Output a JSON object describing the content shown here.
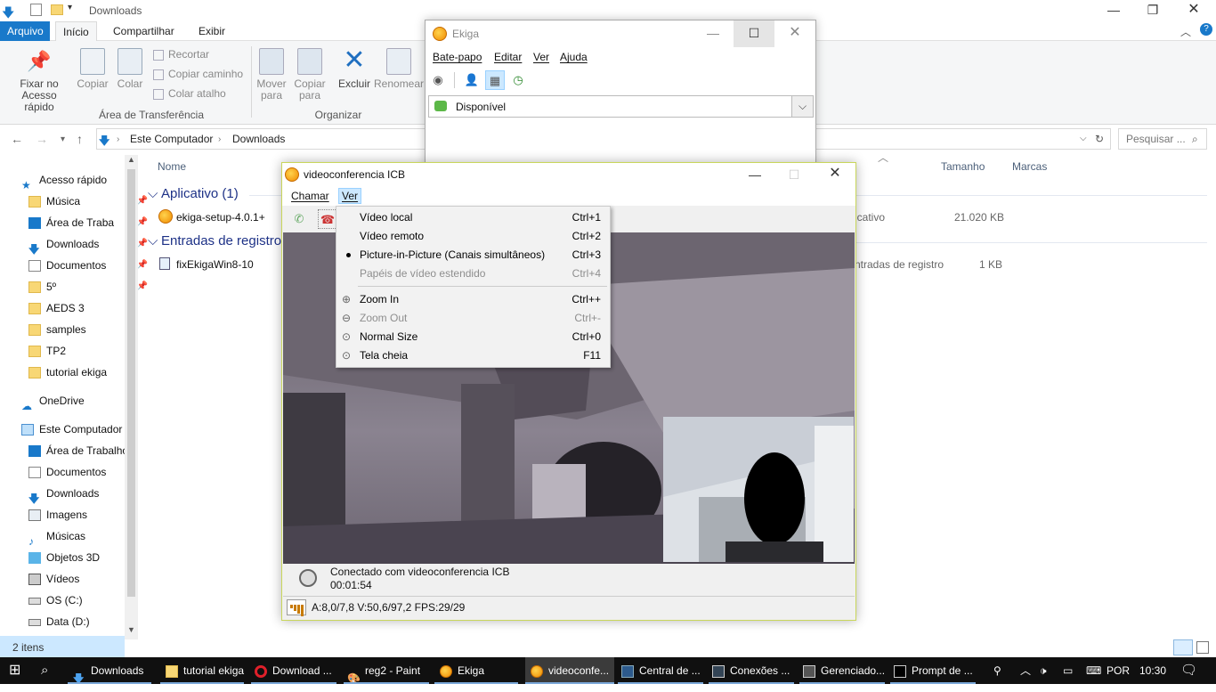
{
  "explorer": {
    "title": "Downloads",
    "tabs": {
      "arquivo": "Arquivo",
      "inicio": "Início",
      "compartilhar": "Compartilhar",
      "exibir": "Exibir"
    },
    "ribbon": {
      "fixar": "Fixar no",
      "fixar2": "Acesso rápido",
      "copiar": "Copiar",
      "colar": "Colar",
      "recortar": "Recortar",
      "copiar_caminho": "Copiar caminho",
      "colar_atalho": "Colar atalho",
      "grupo_transferencia": "Área de Transferência",
      "mover": "Mover",
      "mover2": "para",
      "copiar_para": "Copiar",
      "copiar_para2": "para",
      "excluir": "Excluir",
      "renomear": "Renomear",
      "grupo_organizar": "Organizar"
    },
    "address": {
      "part1": "Este Computador",
      "part2": "Downloads",
      "search_placeholder": "Pesquisar ..."
    },
    "nav": {
      "acesso_rapido": "Acesso rápido",
      "musica": "Música",
      "area_trab": "Área de Traba",
      "downloads": "Downloads",
      "documentos": "Documentos",
      "quinto": "5º",
      "aeds": "AEDS 3",
      "samples": "samples",
      "tp2": "TP2",
      "tutorial": "tutorial ekiga",
      "onedrive": "OneDrive",
      "este_comp": "Este Computador",
      "area_trabalho": "Área de Trabalho",
      "documentos2": "Documentos",
      "downloads2": "Downloads",
      "imagens": "Imagens",
      "musicas": "Músicas",
      "objetos": "Objetos 3D",
      "videos": "Vídeos",
      "osc": "OS (C:)",
      "datad": "Data (D:)"
    },
    "columns": {
      "nome": "Nome",
      "tamanho": "Tamanho",
      "marcas": "Marcas"
    },
    "groups": {
      "aplicativo": "Aplicativo (1)",
      "registro": "Entradas de registro"
    },
    "rows": [
      {
        "name": "ekiga-setup-4.0.1+",
        "type": "icativo",
        "size": "21.020 KB"
      },
      {
        "name": "fixEkigaWin8-10",
        "type": "ntradas de registro",
        "size": "1 KB"
      }
    ],
    "status": "2 itens"
  },
  "ekiga": {
    "title": "Ekiga",
    "menus": {
      "batepapo": "Bate-papo",
      "editar": "Editar",
      "ver": "Ver",
      "ajuda": "Ajuda"
    },
    "presence": "Disponível"
  },
  "vc": {
    "title": "videoconferencia ICB",
    "menus": {
      "chamar": "Chamar",
      "ver": "Ver"
    },
    "status_line1": "Conectado com videoconferencia ICB",
    "status_line2": "00:01:54",
    "stats": "A:8,0/7,8 V:50,6/97,2 FPS:29/29"
  },
  "dropdown": {
    "items": [
      {
        "label": "Vídeo local",
        "shortcut": "Ctrl+1"
      },
      {
        "label": "Vídeo remoto",
        "shortcut": "Ctrl+2"
      },
      {
        "label": "Picture-in-Picture (Canais simultâneos)",
        "shortcut": "Ctrl+3"
      },
      {
        "label": "Papéis de vídeo estendido",
        "shortcut": "Ctrl+4"
      },
      {
        "label": "Zoom In",
        "shortcut": "Ctrl++"
      },
      {
        "label": "Zoom Out",
        "shortcut": "Ctrl+-"
      },
      {
        "label": "Normal Size",
        "shortcut": "Ctrl+0"
      },
      {
        "label": "Tela cheia",
        "shortcut": "F11"
      }
    ]
  },
  "taskbar": {
    "items": [
      "Downloads",
      "tutorial ekiga",
      "Download ...",
      "reg2 - Paint",
      "Ekiga",
      "videoconfe...",
      "Central de ...",
      "Conexões ...",
      "Gerenciado...",
      "Prompt de ..."
    ],
    "lang": "POR",
    "time": "10:30"
  }
}
